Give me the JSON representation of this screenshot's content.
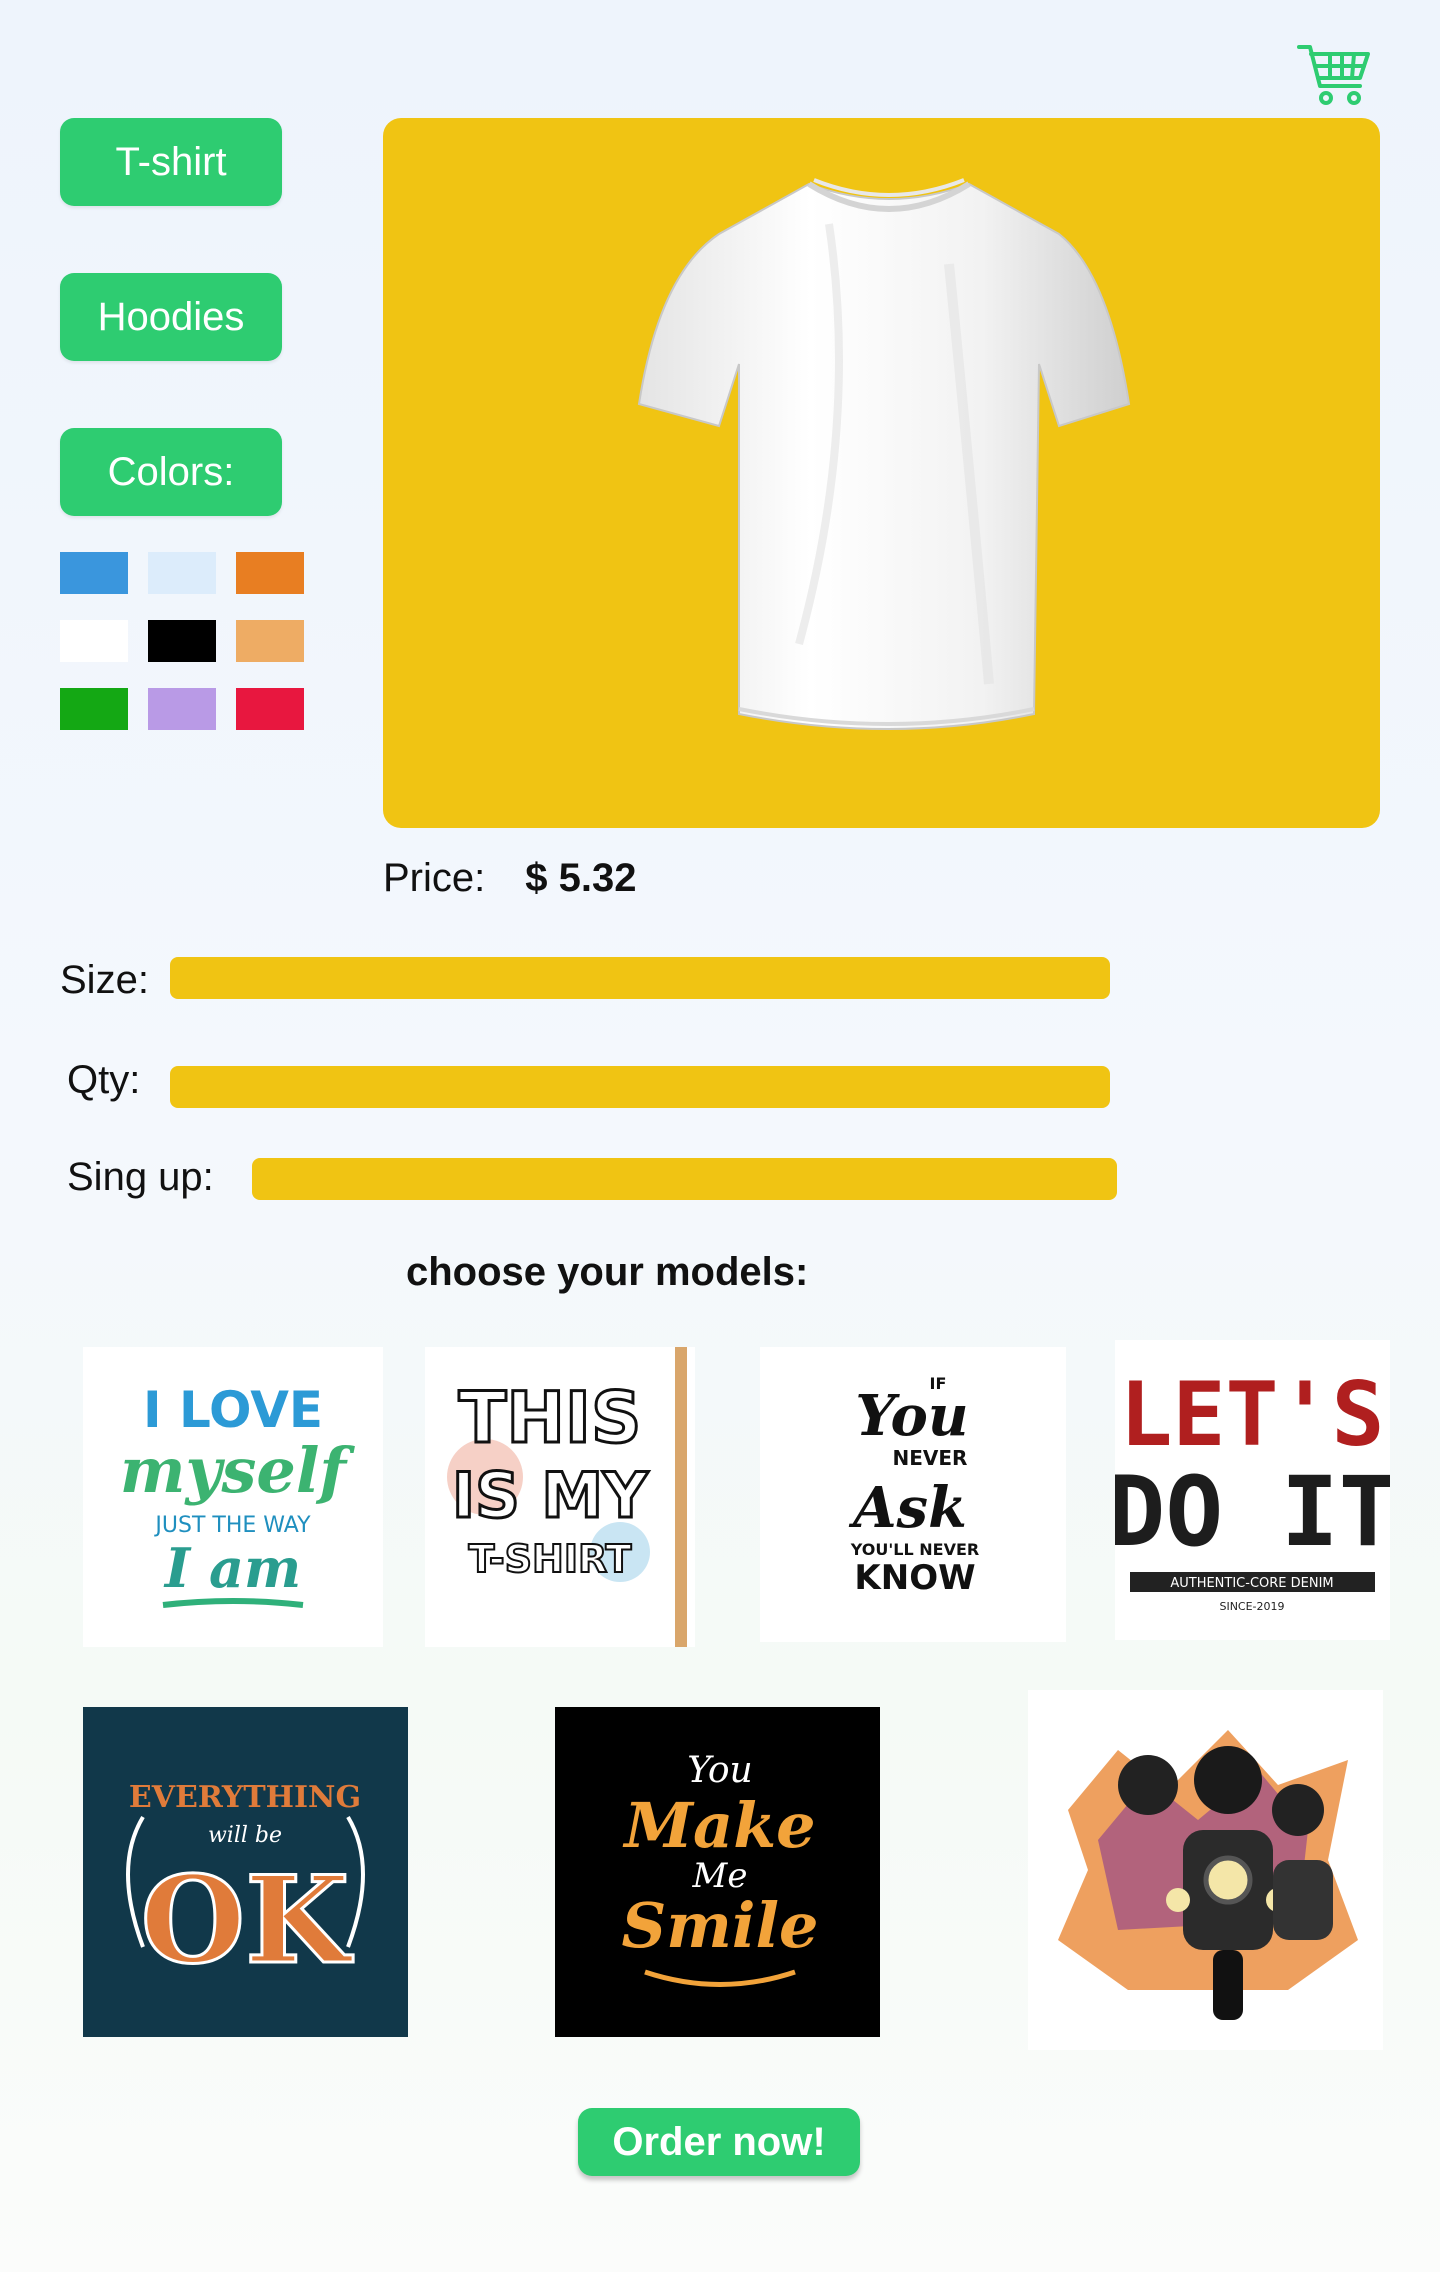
{
  "header": {
    "cart_icon": "shopping-cart-icon"
  },
  "sidebar": {
    "tshirt_label": "T-shirt",
    "hoodies_label": "Hoodies",
    "colors_label": "Colors:",
    "swatches": [
      "#3a96dd",
      "#dcecfb",
      "#e87e22",
      "#ffffff",
      "#000000",
      "#eeac64",
      "#14a814",
      "#b99ae6",
      "#e8173f"
    ]
  },
  "product": {
    "background": "#f0c413",
    "price_label": "Price:",
    "price_value": "$ 5.32"
  },
  "form": {
    "size_label": "Size:",
    "qty_label": "Qty:",
    "signup_label": "Sing up:"
  },
  "models": {
    "title": "choose your models:",
    "m1": {
      "line1": "I LOVE",
      "line2": "myself",
      "line3": "JUST THE WAY",
      "line4": "I am"
    },
    "m2": {
      "line1": "THIS",
      "line2": "IS MY",
      "line3": "T-SHIRT"
    },
    "m3": {
      "if": "IF",
      "you": "You",
      "never": "NEVER",
      "ask": "Ask",
      "youll": "YOU'LL NEVER",
      "know": "KNOW"
    },
    "m4": {
      "line1": "LET'S",
      "line2": "DO IT",
      "band": "AUTHENTIC-CORE DENIM",
      "since": "SINCE-2019"
    },
    "m5": {
      "line1": "EVERYTHING",
      "line2": "will be",
      "line3": "OK"
    },
    "m6": {
      "line1": "You",
      "line2": "Make",
      "line3": "Me",
      "line4": "Smile"
    }
  },
  "order_label": "Order now!"
}
